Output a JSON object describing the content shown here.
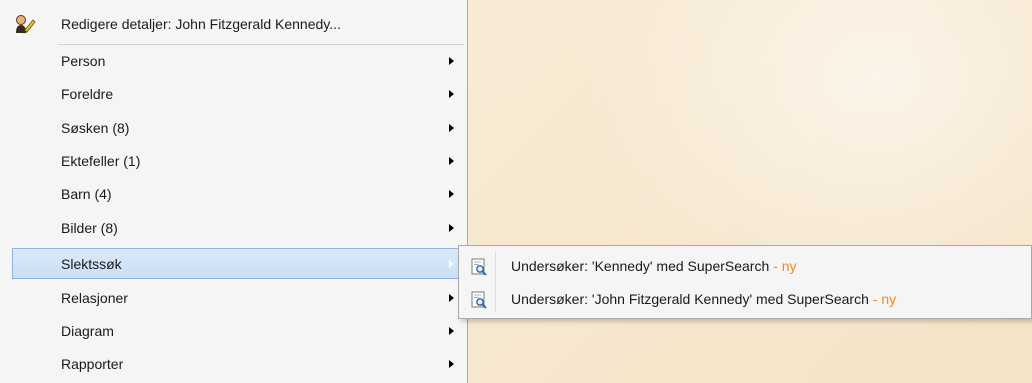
{
  "menu": {
    "top_item": {
      "label": "Redigere detaljer: John Fitzgerald Kennedy...",
      "icon": "edit-person-icon"
    },
    "items": [
      {
        "label": "Person",
        "has_submenu": true,
        "selected": false
      },
      {
        "label": "Foreldre",
        "has_submenu": true,
        "selected": false
      },
      {
        "label": "Søsken (8)",
        "has_submenu": true,
        "selected": false
      },
      {
        "label": "Ektefeller (1)",
        "has_submenu": true,
        "selected": false
      },
      {
        "label": "Barn (4)",
        "has_submenu": true,
        "selected": false
      },
      {
        "label": "Bilder (8)",
        "has_submenu": true,
        "selected": false
      },
      {
        "label": "Slektssøk",
        "has_submenu": true,
        "selected": true
      },
      {
        "label": "Relasjoner",
        "has_submenu": true,
        "selected": false
      },
      {
        "label": "Diagram",
        "has_submenu": true,
        "selected": false
      },
      {
        "label": "Rapporter",
        "has_submenu": true,
        "selected": false
      }
    ]
  },
  "submenu": {
    "items": [
      {
        "label": "Undersøker: 'Kennedy' med SuperSearch",
        "badge": "- ny",
        "icon": "search-document-icon"
      },
      {
        "label": "Undersøker: 'John Fitzgerald Kennedy' med SuperSearch",
        "badge": "- ny",
        "icon": "search-document-icon"
      }
    ]
  },
  "colors": {
    "accent_badge": "#f08a22",
    "selection_fill": "#c9def5",
    "selection_border": "#8db2e3"
  }
}
